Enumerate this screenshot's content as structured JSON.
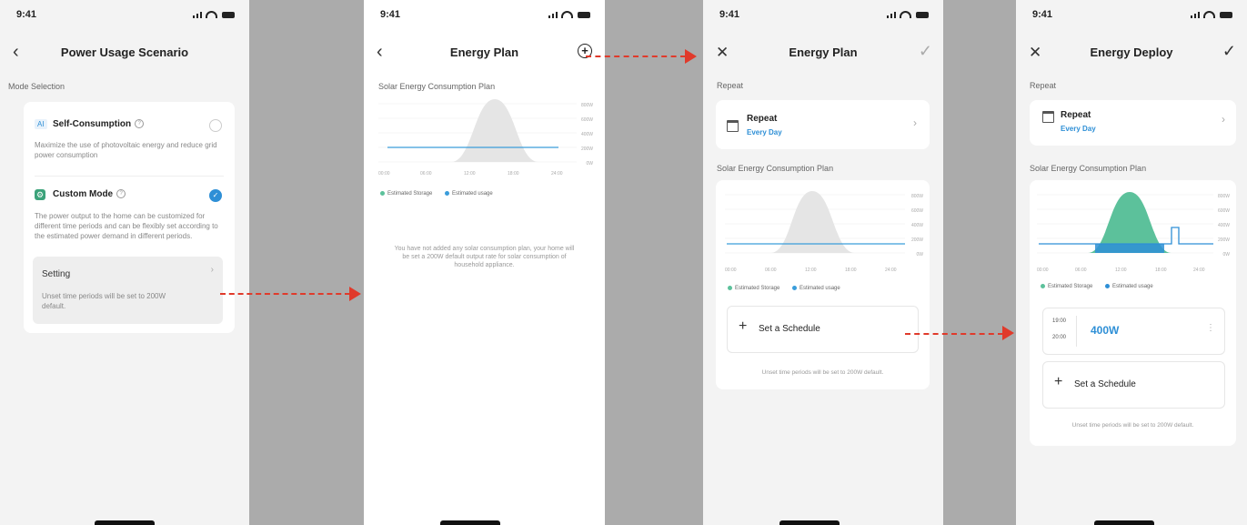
{
  "status_time": "9:41",
  "screen1": {
    "title": "Power Usage Scenario",
    "section": "Mode Selection",
    "self": {
      "badge": "AI",
      "title": "Self-Consumption",
      "desc": "Maximize the use of photovoltaic energy and reduce grid power consumption"
    },
    "custom": {
      "title": "Custom Mode",
      "desc": "The power output to the home can be customized for different time periods and can be flexibly set according to the estimated power demand in different periods."
    },
    "setting": {
      "title": "Setting",
      "desc": "Unset time periods will be set to 200W default."
    }
  },
  "screen2": {
    "title": "Energy Plan",
    "section": "Solar Energy Consumption Plan",
    "message": "You have not added any solar consumption plan, your home will be set a 200W default output rate for solar consumption of household appliance."
  },
  "screen3": {
    "title": "Energy Plan",
    "section_repeat": "Repeat",
    "repeat_title": "Repeat",
    "repeat_value": "Every Day",
    "section_plan": "Solar Energy Consumption Plan",
    "add_label": "Set a Schedule",
    "footer": "Unset time periods will be set to 200W default."
  },
  "screen4": {
    "title": "Energy Deploy",
    "section_repeat": "Repeat",
    "repeat_title": "Repeat",
    "repeat_value": "Every Day",
    "section_plan": "Solar Energy Consumption Plan",
    "schedule": {
      "start": "19:00",
      "end": "20:00",
      "power": "400W"
    },
    "add_label": "Set a Schedule",
    "footer": "Unset time periods will be set to 200W default."
  },
  "chart": {
    "y_ticks": [
      "800W",
      "600W",
      "400W",
      "200W",
      "0W"
    ],
    "x_ticks": [
      "00:00",
      "06:00",
      "12:00",
      "18:00",
      "24:00"
    ],
    "legend_storage": "Estimated Storage",
    "legend_usage": "Estimated usage"
  },
  "colors": {
    "accent": "#2e8fd6",
    "storage": "#5cc19b",
    "arrow": "#e03a2b"
  }
}
